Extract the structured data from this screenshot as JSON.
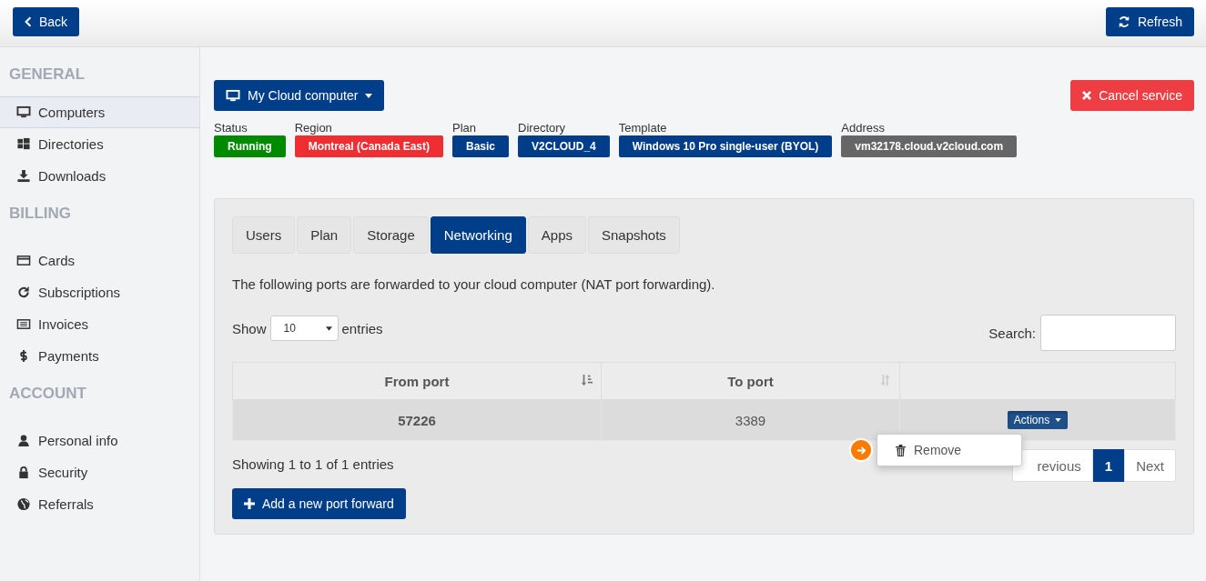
{
  "topbar": {
    "back": "Back",
    "refresh": "Refresh"
  },
  "sidebar": [
    {
      "heading": "GENERAL",
      "items": [
        {
          "label": "Computers",
          "selected": true
        },
        {
          "label": "Directories",
          "selected": false
        },
        {
          "label": "Downloads",
          "selected": false
        }
      ]
    },
    {
      "heading": "BILLING",
      "items": [
        {
          "label": "Cards",
          "selected": false
        },
        {
          "label": "Subscriptions",
          "selected": false
        },
        {
          "label": "Invoices",
          "selected": false
        },
        {
          "label": "Payments",
          "selected": false
        }
      ]
    },
    {
      "heading": "ACCOUNT",
      "items": [
        {
          "label": "Personal info",
          "selected": false
        },
        {
          "label": "Security",
          "selected": false
        },
        {
          "label": "Referrals",
          "selected": false
        }
      ]
    }
  ],
  "computer_menu": "My Cloud computer",
  "cancel": "Cancel service",
  "info": [
    {
      "label": "Status",
      "value": "Running",
      "color": "#008a00"
    },
    {
      "label": "Region",
      "value": "Montreal (Canada East)",
      "color": "#ee2e31"
    },
    {
      "label": "Plan",
      "value": "Basic",
      "color": "#003e8a"
    },
    {
      "label": "Directory",
      "value": "V2CLOUD_4",
      "color": "#003e8a"
    },
    {
      "label": "Template",
      "value": "Windows 10 Pro single-user (BYOL)",
      "color": "#003e8a"
    },
    {
      "label": "Address",
      "value": "vm32178.cloud.v2cloud.com",
      "color": "#666666"
    }
  ],
  "tabs": [
    {
      "label": "Users",
      "selected": false
    },
    {
      "label": "Plan",
      "selected": false
    },
    {
      "label": "Storage",
      "selected": false
    },
    {
      "label": "Networking",
      "selected": true
    },
    {
      "label": "Apps",
      "selected": false
    },
    {
      "label": "Snapshots",
      "selected": false
    }
  ],
  "description": "The following ports are forwarded to your cloud computer (NAT port forwarding).",
  "length": {
    "show": "Show",
    "value": "10",
    "entries": "entries"
  },
  "search": {
    "label": "Search:"
  },
  "table": {
    "columns": [
      {
        "label": "From port",
        "sorted": true
      },
      {
        "label": "To port",
        "sorted": false
      }
    ],
    "rows": [
      {
        "cells": [
          "57226",
          "3389"
        ],
        "actions": "Actions",
        "expanded": true
      }
    ]
  },
  "menu": [
    {
      "label": "Remove"
    }
  ],
  "info_text": "Showing 1 to 1 of 1 entries",
  "pager": [
    {
      "label": "revious",
      "kind": "prev",
      "selected": false
    },
    {
      "label": "1",
      "kind": "page",
      "selected": true
    },
    {
      "label": "Next",
      "kind": "next",
      "selected": false
    }
  ],
  "add_button": "Add a new port forward"
}
